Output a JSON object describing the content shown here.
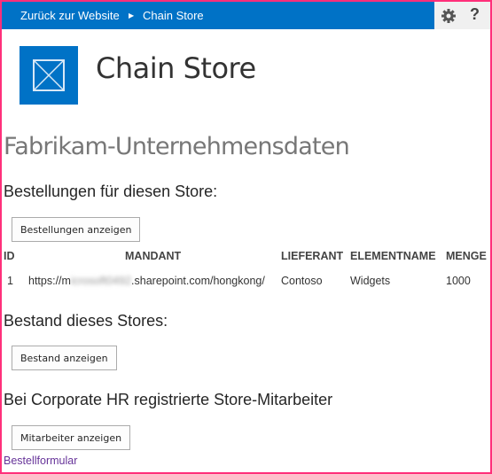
{
  "topbar": {
    "back_label": "Zurück zur Website",
    "separator_icon": "triangle-right-icon",
    "current_label": "Chain Store",
    "settings_icon": "gear-icon",
    "help_label": "?"
  },
  "site": {
    "logo_icon": "site-logo-icon",
    "title": "Chain Store"
  },
  "page": {
    "title": "Fabrikam-Unternehmensdaten"
  },
  "orders": {
    "heading": "Bestellungen für diesen Store:",
    "button_label": "Bestellungen anzeigen",
    "columns": [
      "ID",
      "MANDANT",
      "LIEFERANT",
      "ELEMENTNAME",
      "MENGE"
    ],
    "rows": [
      {
        "id": "1",
        "mandant_prefix": "https://m",
        "mandant_obscured": "icrosoft0492",
        "mandant_suffix": ".sharepoint.com/hongkong/",
        "lieferant": "Contoso",
        "elementname": "Widgets",
        "menge": "1000"
      }
    ]
  },
  "inventory": {
    "heading": "Bestand dieses Stores:",
    "button_label": "Bestand anzeigen"
  },
  "employees": {
    "heading": "Bei Corporate HR registrierte Store-Mitarbeiter",
    "button_label": "Mitarbeiter anzeigen"
  },
  "footer_link": "Bestellformular",
  "colors": {
    "brand": "#0072c6",
    "frame": "#ff2f7a",
    "link": "#663399"
  }
}
